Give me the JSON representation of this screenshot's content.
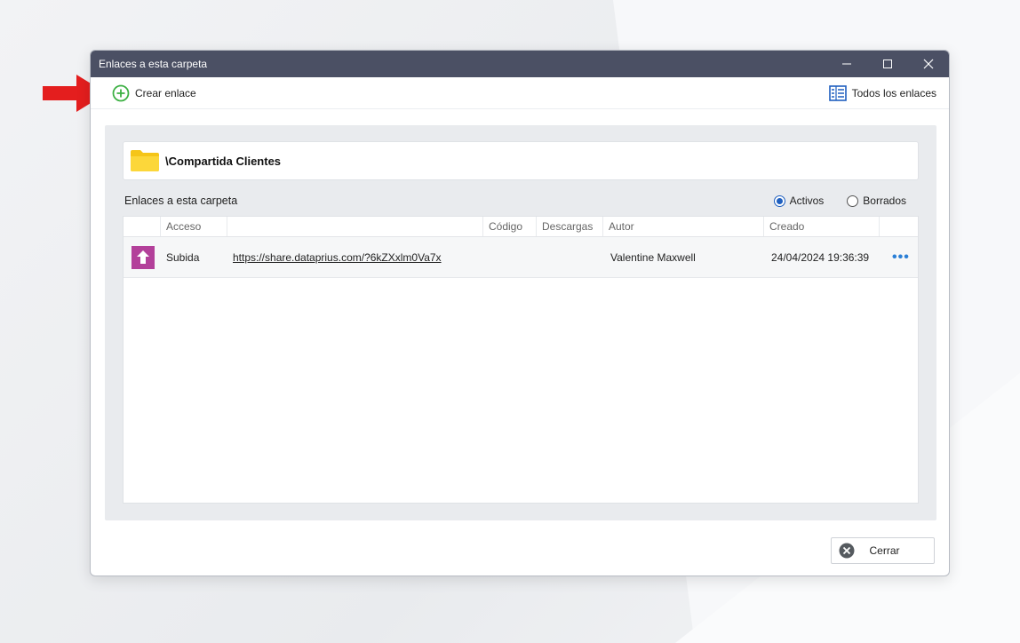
{
  "window": {
    "title": "Enlaces a esta carpeta"
  },
  "toolbar": {
    "create_label": "Crear enlace",
    "all_links_label": "Todos los enlaces"
  },
  "folder": {
    "name": "\\Compartida Clientes"
  },
  "section": {
    "title": "Enlaces a esta carpeta",
    "filters": [
      {
        "label": "Activos",
        "selected": true
      },
      {
        "label": "Borrados",
        "selected": false
      }
    ]
  },
  "table": {
    "columns": [
      "Acceso",
      "Código",
      "Descargas",
      "Autor",
      "Creado"
    ],
    "rows": [
      {
        "type_icon": "upload-arrow-icon",
        "access": "Subida",
        "url": "https://share.dataprius.com/?6kZXxlm0Va7x",
        "code": "",
        "downloads": "",
        "author": "Valentine Maxwell",
        "created": "24/04/2024 19:36:39",
        "more": "•••"
      }
    ]
  },
  "footer": {
    "close_label": "Cerrar"
  },
  "colors": {
    "titlebar": "#4b5064",
    "accent_blue": "#1f5fbf",
    "create_green": "#3cb043",
    "upload_purple": "#b3409a",
    "folder_yellow": "#f5c518",
    "arrow_red": "#e41e1e"
  }
}
